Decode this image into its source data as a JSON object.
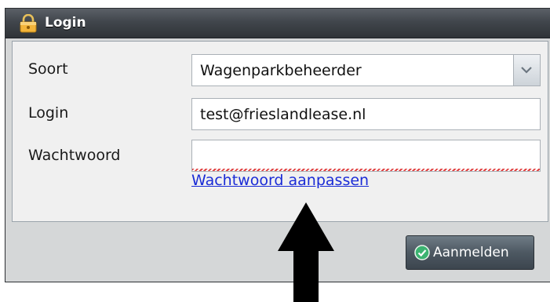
{
  "window": {
    "title": "Login",
    "title_icon": "lock-icon"
  },
  "form": {
    "soort": {
      "label": "Soort",
      "value": "Wagenparkbeheerder",
      "trigger_icon": "chevron-down-icon"
    },
    "login": {
      "label": "Login",
      "value": "test@frieslandlease.nl"
    },
    "password": {
      "label": "Wachtwoord",
      "value": ""
    },
    "change_password_link": "Wachtwoord aanpassen"
  },
  "footer": {
    "login_button_label": "Aanmelden",
    "login_button_icon": "check-circle-icon"
  },
  "annotation": {
    "icon": "up-arrow-icon",
    "color": "#000000"
  },
  "colors": {
    "titlebar": "#41464c",
    "link": "#1a2bd6",
    "button_icon": "#3cb371"
  }
}
